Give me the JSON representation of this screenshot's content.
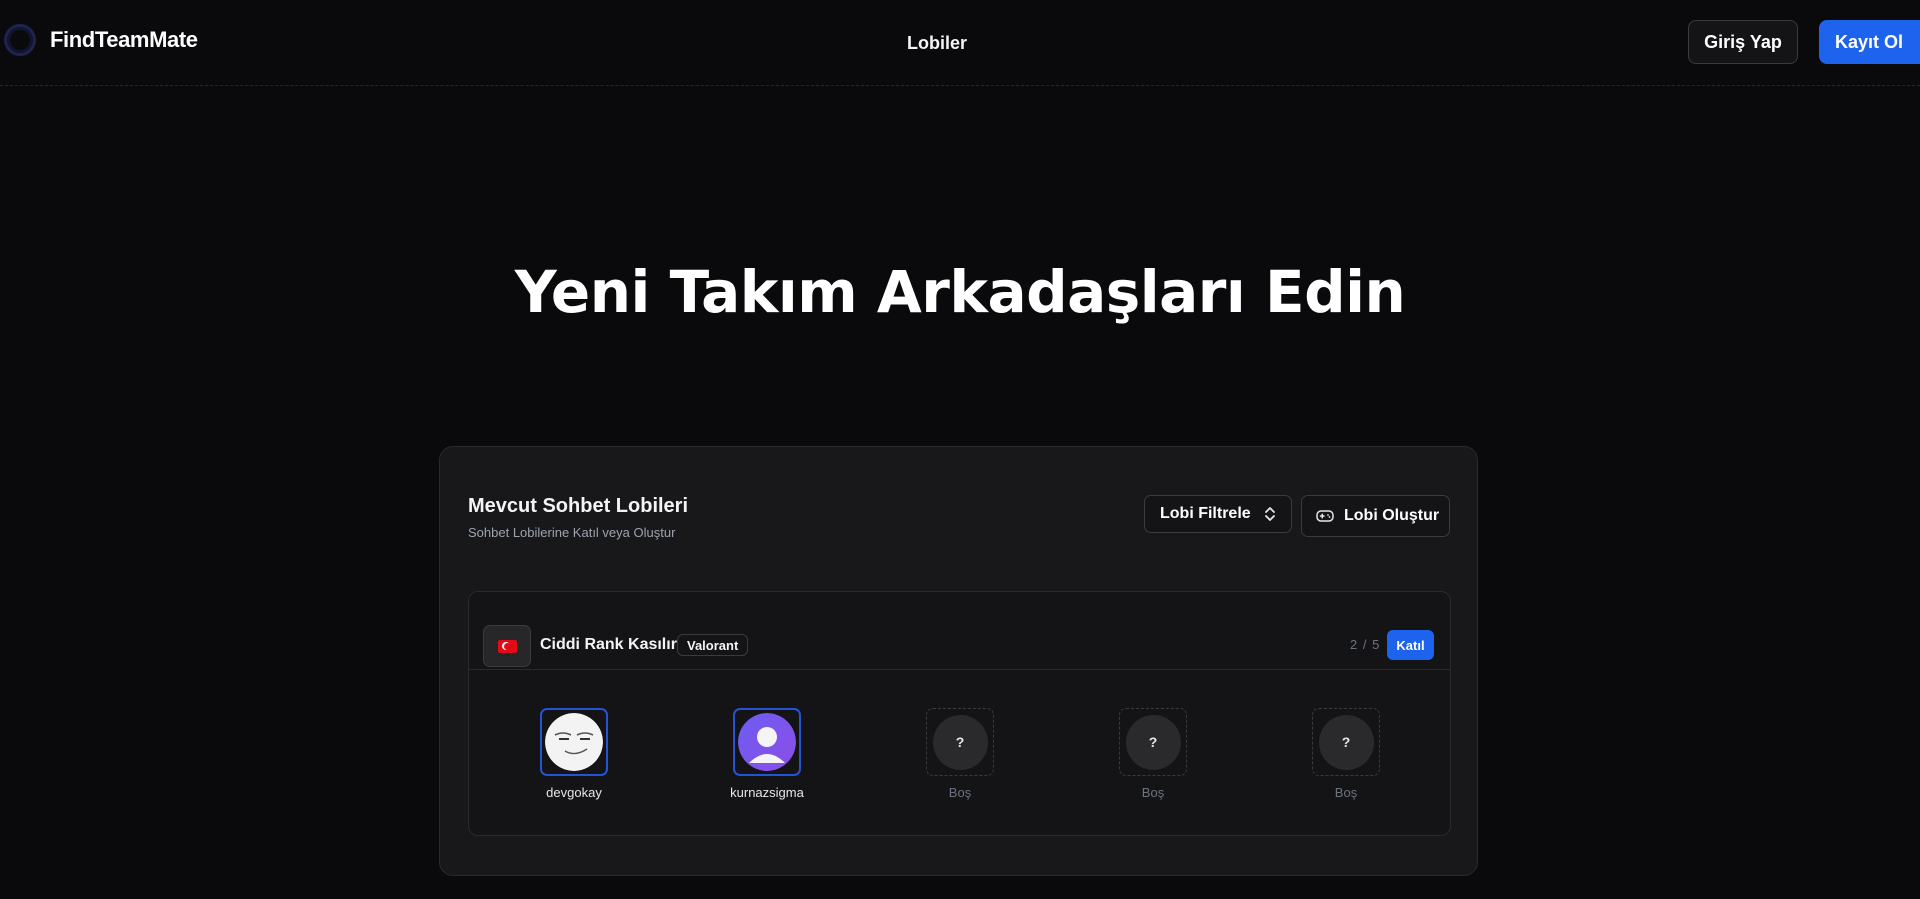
{
  "header": {
    "brand": "FindTeamMate",
    "nav_lobbies": "Lobiler",
    "login_label": "Giriş Yap",
    "signup_label": "Kayıt Ol"
  },
  "hero": {
    "title": "Yeni Takım Arkadaşları Edin"
  },
  "panel": {
    "title": "Mevcut Sohbet Lobileri",
    "subtitle": "Sohbet Lobilerine Katıl veya Oluştur",
    "filter_label": "Lobi Filtrele",
    "create_label": "Lobi Oluştur"
  },
  "lobby": {
    "name": "Ciddi Rank Kasılır",
    "game": "Valorant",
    "count": "2 / 5",
    "join_label": "Katıl",
    "slots": [
      {
        "name": "devgokay",
        "status": "filled"
      },
      {
        "name": "kurnazsigma",
        "status": "filled"
      },
      {
        "name": "Boş",
        "placeholder": "?",
        "status": "empty"
      },
      {
        "name": "Boş",
        "placeholder": "?",
        "status": "empty"
      },
      {
        "name": "Boş",
        "placeholder": "?",
        "status": "empty"
      }
    ]
  },
  "colors": {
    "background": "#0a0a0c",
    "panel": "#18181b",
    "accent": "#1d63ed",
    "muted_text": "#6b7280"
  },
  "icons": [
    "logo-icon",
    "chevron-up-down-icon",
    "gamepad-icon",
    "turkey-flag-icon",
    "question-icon"
  ]
}
